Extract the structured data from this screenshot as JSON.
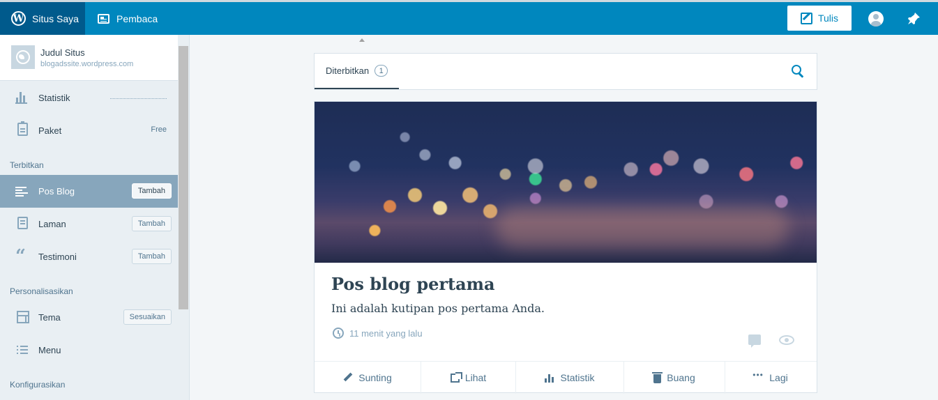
{
  "topbar": {
    "my_site_label": "Situs Saya",
    "reader_label": "Pembaca",
    "write_label": "Tulis",
    "colors": {
      "bar": "#0087be",
      "my_site_bg": "#005a8c"
    }
  },
  "sidebar": {
    "site": {
      "title": "Judul Situs",
      "url": "blogadssite.wordpress.com"
    },
    "stats_label": "Statistik",
    "plan": {
      "label": "Paket",
      "badge": "Free"
    },
    "sections": {
      "publish": "Terbitkan",
      "personalize": "Personalisasikan",
      "configure": "Konfigurasikan"
    },
    "items": [
      {
        "label": "Pos Blog",
        "button": "Tambah",
        "active": true
      },
      {
        "label": "Laman",
        "button": "Tambah"
      },
      {
        "label": "Testimoni",
        "button": "Tambah"
      },
      {
        "label": "Tema",
        "button": "Sesuaikan"
      },
      {
        "label": "Menu"
      }
    ]
  },
  "tabs": {
    "published_label": "Diterbitkan",
    "published_count": "1"
  },
  "post": {
    "title": "Pos blog pertama",
    "excerpt": "Ini adalah kutipan pos pertama Anda.",
    "time": "11 menit yang lalu",
    "actions": {
      "edit": "Sunting",
      "view": "Lihat",
      "stats": "Statistik",
      "trash": "Buang",
      "more": "Lagi"
    }
  }
}
